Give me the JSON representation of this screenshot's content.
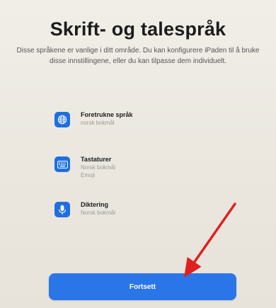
{
  "header": {
    "title": "Skrift- og talespråk",
    "subtitle": "Disse språkene er vanlige i ditt område. Du kan konfigurere iPaden til å bruke disse innstillingene, eller du kan tilpasse dem individuelt."
  },
  "items": [
    {
      "icon": "globe-icon",
      "title": "Foretrukne språk",
      "lines": [
        "norsk bokmål"
      ]
    },
    {
      "icon": "keyboard-icon",
      "title": "Tastaturer",
      "lines": [
        "Norsk bokmål",
        "Emoji"
      ]
    },
    {
      "icon": "microphone-icon",
      "title": "Diktering",
      "lines": [
        "Norsk bokmål"
      ]
    }
  ],
  "continue_button": {
    "label": "Fortsett"
  },
  "colors": {
    "accent": "#2a76e8",
    "icon_background": "#1f6fe0",
    "annotation_arrow": "#e02020"
  }
}
